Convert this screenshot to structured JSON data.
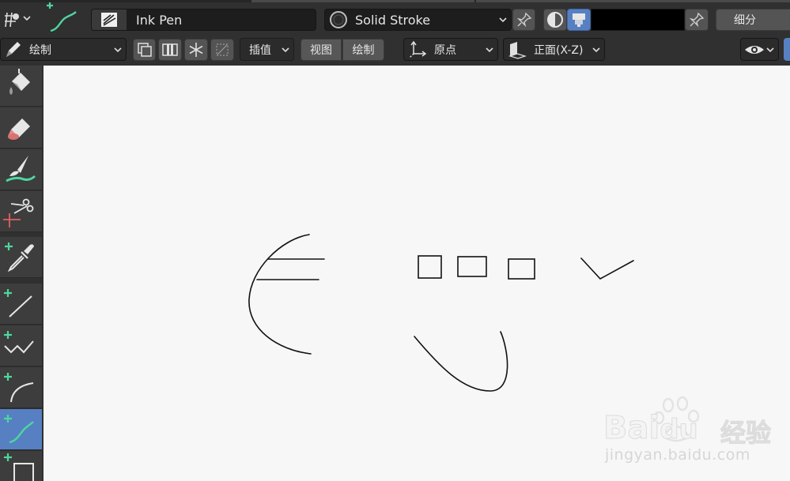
{
  "header": {
    "brush_name": "Ink Pen",
    "material_name": "Solid Stroke",
    "color_hex": "#000000",
    "subdivide_label": "细分"
  },
  "toolbar2": {
    "mode_label": "绘制",
    "interpolate_label": "插值",
    "view_label": "视图",
    "draw_label": "绘制",
    "origin_label": "原点",
    "orientation_label": "正面(X-Z)"
  },
  "tools": [
    {
      "name": "fill-tool",
      "icon": "paint-bucket-icon"
    },
    {
      "name": "erase-tool",
      "icon": "eraser-icon"
    },
    {
      "name": "tint-tool",
      "icon": "tint-brush-icon"
    },
    {
      "name": "cutter-tool",
      "icon": "scissors-icon"
    },
    {
      "name": "eyedropper-tool",
      "icon": "eyedropper-icon"
    },
    {
      "name": "line-tool",
      "icon": "line-icon"
    },
    {
      "name": "polyline-tool",
      "icon": "polyline-icon"
    },
    {
      "name": "arc-tool",
      "icon": "arc-icon"
    },
    {
      "name": "curve-tool",
      "icon": "curve-icon",
      "active": true
    },
    {
      "name": "box-tool",
      "icon": "box-icon"
    }
  ],
  "colors": {
    "panel": "#303030",
    "active_tool": "#5680c2",
    "canvas": "#f7f7f7",
    "green_accent": "#4ed6a0"
  },
  "watermark": {
    "brand": "Bai",
    "brand2": "du",
    "cn": "经验",
    "url": "jingyan.baidu.com"
  }
}
